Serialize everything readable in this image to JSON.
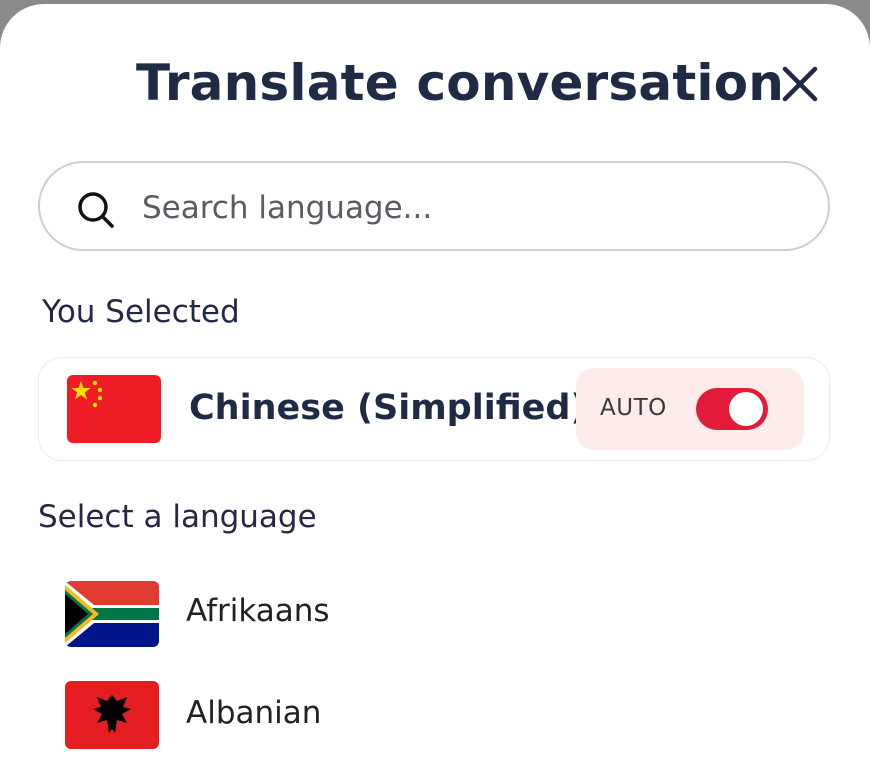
{
  "header": {
    "title": "Translate conversation",
    "close_icon": "close-icon"
  },
  "search": {
    "placeholder": "Search language...",
    "value": "",
    "icon": "search-icon"
  },
  "selected_section": {
    "label": "You Selected",
    "language": {
      "name": "Chinese (Simplified)",
      "flag": "china-flag-icon",
      "auto_label": "AUTO",
      "auto_enabled": true
    }
  },
  "languages_section": {
    "label": "Select a language",
    "items": [
      {
        "name": "Afrikaans",
        "flag": "south-africa-flag-icon"
      },
      {
        "name": "Albanian",
        "flag": "albania-flag-icon"
      }
    ]
  },
  "colors": {
    "title_text": "#1f2a44",
    "toggle_on": "#e31b3a",
    "auto_pill_bg": "#fdecea",
    "search_border": "#cfcfcf"
  }
}
